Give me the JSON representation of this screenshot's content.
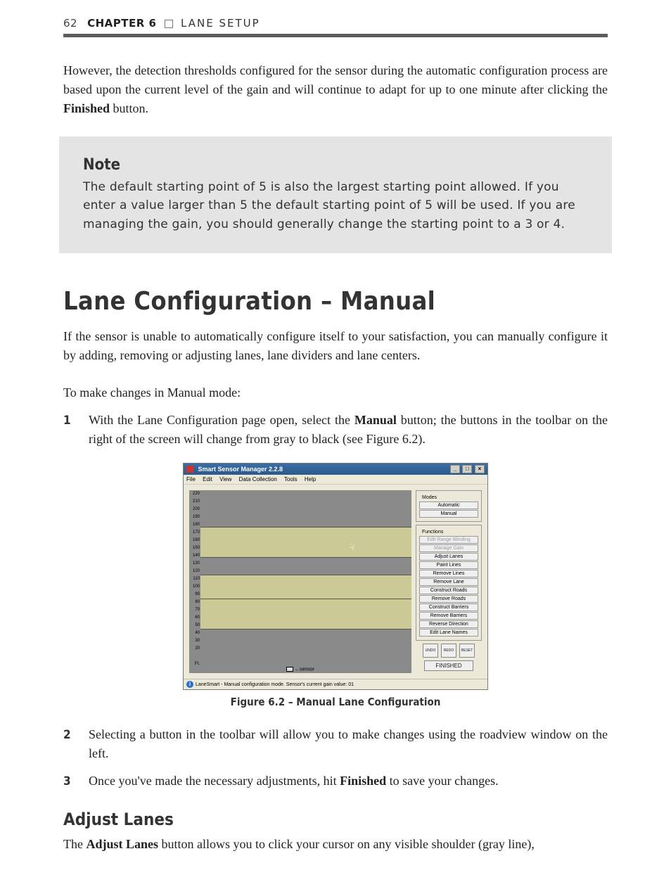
{
  "header": {
    "page_number": "62",
    "chapter_label": "CHAPTER 6",
    "chapter_title": "LANE SETUP"
  },
  "intro_para": {
    "pre": "However, the detection thresholds configured for the sensor during the automatic configuration process are based upon the current level of the gain and will continue to adapt for up to one minute after clicking the ",
    "bold": "Finished",
    "post": " button."
  },
  "note": {
    "title": "Note",
    "body": "The default starting point of 5 is also the largest starting point allowed. If you enter a value larger than 5 the default starting point of 5 will be used. If you are managing the gain, you should generally change the starting point to a 3 or 4."
  },
  "section_title": "Lane Configuration – Manual",
  "section_para1": "If the sensor is unable to automatically configure itself to your satisfaction, you can manually configure it by adding, removing or adjusting lanes, lane dividers and lane centers.",
  "section_para2": "To make changes in Manual mode:",
  "steps": [
    {
      "pre": "With the Lane Configuration page open, select the ",
      "bold": "Manual",
      "post": " button; the buttons in the toolbar on the right of the screen will change from gray to black (see Figure 6.2)."
    },
    {
      "pre": "Selecting a button in the toolbar will allow you to make changes using the roadview window on the left.",
      "bold": "",
      "post": ""
    },
    {
      "pre": "Once you've made the necessary adjustments, hit ",
      "bold": "Finished",
      "post": " to save your changes."
    }
  ],
  "figure": {
    "caption": "Figure 6.2 – Manual Lane Configuration",
    "window_title": "Smart Sensor Manager 2.2.8",
    "menus": [
      "File",
      "Edit",
      "View",
      "Data Collection",
      "Tools",
      "Help"
    ],
    "axis_ticks": [
      "220",
      "210",
      "200",
      "190",
      "180",
      "170",
      "160",
      "150",
      "140",
      "130",
      "120",
      "110",
      "100",
      "90",
      "80",
      "70",
      "60",
      "50",
      "40",
      "30",
      "20"
    ],
    "axis_unit": "Ft.",
    "sensor_label": "sensor",
    "modes": {
      "legend": "Modes",
      "buttons": [
        "Automatic",
        "Manual"
      ]
    },
    "functions": {
      "legend": "Functions",
      "buttons": [
        {
          "label": "Edit Range Blinding",
          "disabled": true
        },
        {
          "label": "Manage Gain",
          "disabled": true
        },
        {
          "label": "Adjust Lanes",
          "disabled": false
        },
        {
          "label": "Paint Lines",
          "disabled": false
        },
        {
          "label": "Remove Lines",
          "disabled": false
        },
        {
          "label": "Remove Lane",
          "disabled": false
        },
        {
          "label": "Construct Roads",
          "disabled": false
        },
        {
          "label": "Remove Roads",
          "disabled": false
        },
        {
          "label": "Construct Barriers",
          "disabled": false
        },
        {
          "label": "Remove Barriers",
          "disabled": false
        },
        {
          "label": "Reverse Direction",
          "disabled": false
        },
        {
          "label": "Edit Lane Names",
          "disabled": false
        }
      ]
    },
    "icon_buttons": [
      "UNDO",
      "REDO",
      "RESET"
    ],
    "finished_label": "FINISHED",
    "status_text": "LaneSmart - Manual configuration mode.  Sensor's current gain value: 01"
  },
  "subsection": {
    "title": "Adjust Lanes",
    "para_pre": "The ",
    "para_bold": "Adjust Lanes",
    "para_post": " button allows you to click your cursor on any visible shoulder (gray line),"
  }
}
